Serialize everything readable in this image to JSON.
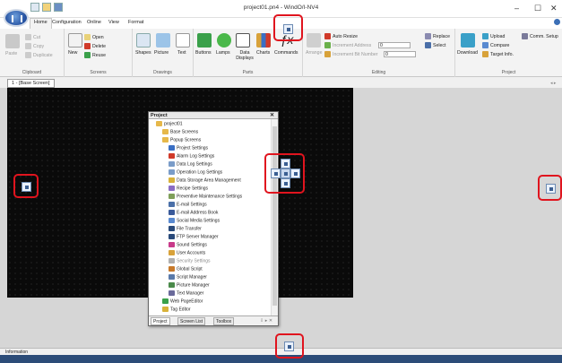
{
  "window": {
    "title": "project01.pn4 - WindO/I-NV4",
    "minimize": "–",
    "maximize": "☐",
    "close": "✕"
  },
  "menu": {
    "tabs": [
      "Home",
      "Configuration",
      "Online",
      "View",
      "Format"
    ]
  },
  "ribbon": {
    "clipboard": {
      "cut": "Cut",
      "copy": "Copy",
      "paste": "Paste",
      "duplicate": "Duplicate",
      "label": "Clipboard"
    },
    "screens": {
      "new": "New",
      "open": "Open",
      "delete": "Delete",
      "reuse": "Reuse",
      "label": "Screens"
    },
    "drawings": {
      "shapes": "Shapes",
      "picture": "Picture",
      "text": "Text",
      "label": "Drawings"
    },
    "parts": {
      "buttons": "Buttons",
      "lamps": "Lamps",
      "data_displays": "Data Displays",
      "charts": "Charts",
      "commands": "Commands",
      "label": "Parts"
    },
    "editing": {
      "arrange": "Arrange",
      "auto_resize": "Auto Resize",
      "increment_address": "Increment Address",
      "increment_address_value": "0",
      "increment_bit_number": "Increment Bit Number",
      "increment_bit_number_value": "0",
      "replace": "Replace",
      "select": "Select",
      "label": "Editing"
    },
    "project": {
      "download": "Download",
      "upload": "Upload",
      "compare": "Compare",
      "target_info": "Target Info.",
      "comm_setup": "Comm. Setup",
      "label": "Project"
    }
  },
  "sheet_tab": "1 - [Base Screen]",
  "project_panel": {
    "title": "Project",
    "close": "✕",
    "items": [
      {
        "label": "project01",
        "indent": 0,
        "color": "#e6b84a",
        "disabled": false
      },
      {
        "label": "Base Screens",
        "indent": 1,
        "color": "#e6b84a",
        "disabled": false
      },
      {
        "label": "Popup Screens",
        "indent": 1,
        "color": "#e6b84a",
        "disabled": false
      },
      {
        "label": "Project Settings",
        "indent": 2,
        "color": "#3a6fc4",
        "disabled": false
      },
      {
        "label": "Alarm Log Settings",
        "indent": 2,
        "color": "#d03a2a",
        "disabled": false
      },
      {
        "label": "Data Log Settings",
        "indent": 2,
        "color": "#7a9cc8",
        "disabled": false
      },
      {
        "label": "Operation Log Settings",
        "indent": 2,
        "color": "#7a9cc8",
        "disabled": false
      },
      {
        "label": "Data Storage Area Management",
        "indent": 2,
        "color": "#d8b23a",
        "disabled": false
      },
      {
        "label": "Recipe Settings",
        "indent": 2,
        "color": "#8a6cc4",
        "disabled": false
      },
      {
        "label": "Preventive Maintenance Settings",
        "indent": 2,
        "color": "#7f9f5a",
        "disabled": false
      },
      {
        "label": "E-mail Settings",
        "indent": 2,
        "color": "#4a6fa8",
        "disabled": false
      },
      {
        "label": "E-mail Address Book",
        "indent": 2,
        "color": "#3a5a9a",
        "disabled": false
      },
      {
        "label": "Social Media Settings",
        "indent": 2,
        "color": "#5a8ad0",
        "disabled": false
      },
      {
        "label": "File Transfer",
        "indent": 2,
        "color": "#2a4a7a",
        "disabled": false
      },
      {
        "label": "FTP Server Manager",
        "indent": 2,
        "color": "#2a4a7a",
        "disabled": false
      },
      {
        "label": "Sound Settings",
        "indent": 2,
        "color": "#c83a8a",
        "disabled": false
      },
      {
        "label": "User Accounts",
        "indent": 2,
        "color": "#d8a23a",
        "disabled": false
      },
      {
        "label": "Security Settings",
        "indent": 2,
        "color": "#b0b0b0",
        "disabled": true
      },
      {
        "label": "Global Script",
        "indent": 2,
        "color": "#c87a2a",
        "disabled": false
      },
      {
        "label": "Script Manager",
        "indent": 2,
        "color": "#5a7aaa",
        "disabled": false
      },
      {
        "label": "Picture Manager",
        "indent": 2,
        "color": "#4a8a4a",
        "disabled": false
      },
      {
        "label": "Text Manager",
        "indent": 2,
        "color": "#6a6a9a",
        "disabled": false
      },
      {
        "label": "Web PageEditor",
        "indent": 1,
        "color": "#3aa04a",
        "disabled": false
      },
      {
        "label": "Tag Editor",
        "indent": 1,
        "color": "#d8b23a",
        "disabled": false
      }
    ],
    "tabs": [
      "Project",
      "Screen List",
      "Toolbox"
    ],
    "pin": "⇩ ▸ ✕"
  },
  "info_label": "Information",
  "colors": {
    "highlight_ring": "#e0141e",
    "status_bar": "#2c4c78",
    "dock_fill": "#eaf1fb"
  }
}
